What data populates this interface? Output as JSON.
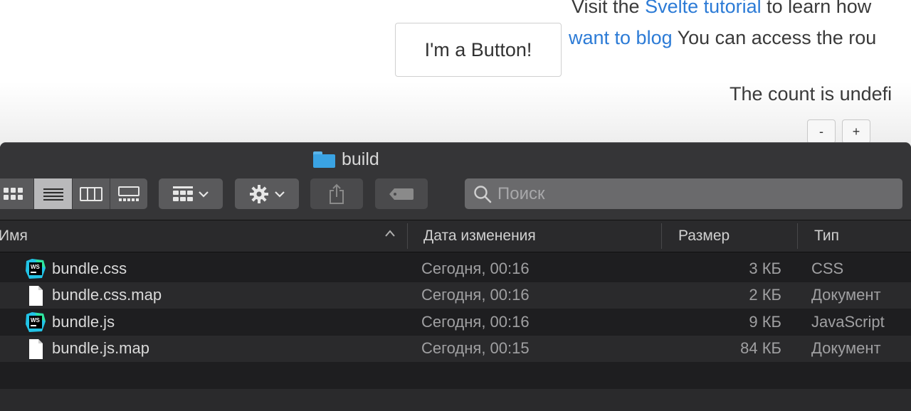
{
  "web": {
    "line1_prefix": "Visit the ",
    "line1_link": "Svelte tutorial",
    "line1_suffix": " to learn how",
    "line2_link": "want to blog",
    "line2_suffix": " You can access the rou",
    "button_label": "I'm a Button!",
    "count_text": "The count is undefi",
    "minus_label": "-",
    "plus_label": "+"
  },
  "finder": {
    "title": "build",
    "search_placeholder": "Поиск",
    "view_modes": [
      "icon-view-icon",
      "list-view-icon",
      "column-view-icon",
      "gallery-view-icon"
    ],
    "active_view": "list-view-icon",
    "columns": {
      "name": "Имя",
      "date": "Дата изменения",
      "size": "Размер",
      "kind": "Тип"
    },
    "files": [
      {
        "name": "bundle.css",
        "date": "Сегодня, 00:16",
        "size": "3 КБ",
        "kind": "CSS",
        "icon": "webstorm",
        "icon_label": "WS"
      },
      {
        "name": "bundle.css.map",
        "date": "Сегодня, 00:16",
        "size": "2 КБ",
        "kind": "Документ",
        "icon": "document"
      },
      {
        "name": "bundle.js",
        "date": "Сегодня, 00:16",
        "size": "9 КБ",
        "kind": "JavaScript",
        "icon": "webstorm",
        "icon_label": "WS"
      },
      {
        "name": "bundle.js.map",
        "date": "Сегодня, 00:15",
        "size": "84 КБ",
        "kind": "Документ",
        "icon": "document"
      }
    ]
  },
  "colors": {
    "link": "#2c7bd6",
    "folder": "#3aa3e3",
    "window_bg": "#1e1e20",
    "toolbar_bg": "#353537"
  }
}
